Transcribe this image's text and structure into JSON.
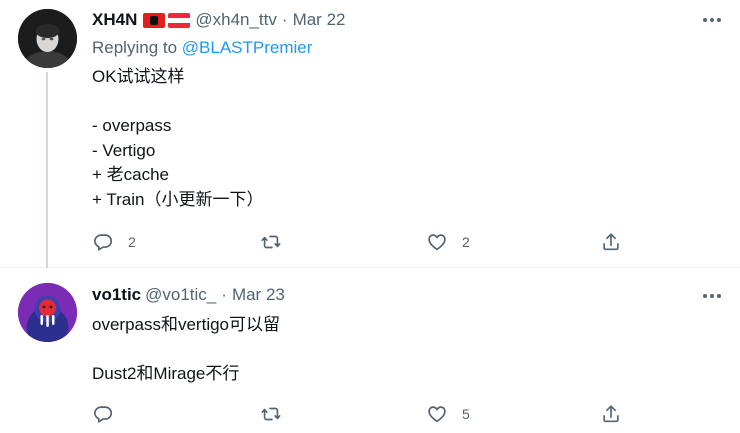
{
  "tweets": [
    {
      "display_name": "XH4N",
      "handle": "@xh4n_ttv",
      "separator": "·",
      "date": "Mar 22",
      "replying_to_prefix": "Replying to ",
      "replying_to_mention": "@BLASTPremier",
      "text": "OK试试这样\n\n- overpass\n- Vertigo\n+ 老cache\n+ Train（小更新一下）",
      "flags": [
        "albania-flag-icon",
        "austria-flag-icon"
      ],
      "reply_count": "2",
      "retweet_count": "",
      "like_count": "2"
    },
    {
      "display_name": "vo1tic",
      "handle": "@vo1tic_",
      "separator": "·",
      "date": "Mar 23",
      "text": "overpass和vertigo可以留\n\nDust2和Mirage不行",
      "reply_count": "",
      "retweet_count": "",
      "like_count": "5"
    }
  ],
  "icons": {
    "reply": "reply-bubble-icon",
    "retweet": "retweet-icon",
    "like": "heart-icon",
    "share": "share-icon",
    "more": "more-dots-icon"
  },
  "colors": {
    "text": "#0f1419",
    "secondary": "#536471",
    "link": "#1d9bf0",
    "divider": "#eff3f4"
  }
}
